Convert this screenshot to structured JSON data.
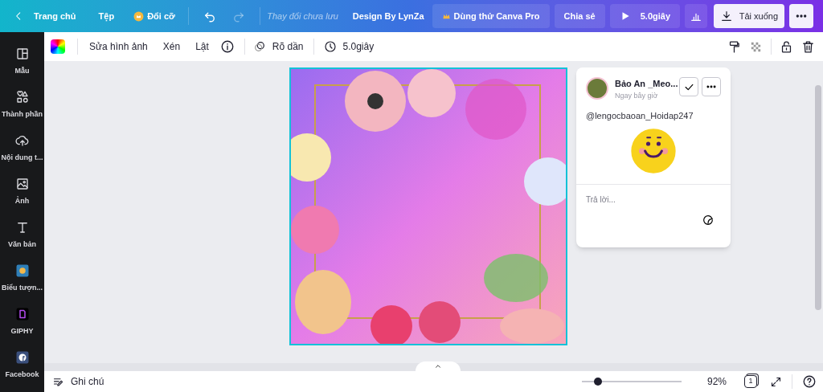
{
  "topbar": {
    "back": "Trang chủ",
    "file": "Tệp",
    "resize": "Đổi cỡ",
    "history": [
      {
        "kind": "undo",
        "disabled": false
      },
      {
        "kind": "redo",
        "disabled": true
      }
    ],
    "status": "Thay đổi chưa lưu",
    "title": "Design By LynZa",
    "pro": "Dùng thử Canva Pro",
    "share": "Chia sẻ",
    "play": "5.0giây",
    "download": "Tải xuống"
  },
  "sidebar": {
    "items": [
      {
        "label": "Mẫu",
        "kind": "templates"
      },
      {
        "label": "Thành phần",
        "kind": "elements"
      },
      {
        "label": "Nội dung t...",
        "kind": "uploads"
      },
      {
        "label": "Ảnh",
        "kind": "photos"
      },
      {
        "label": "Văn bản",
        "kind": "text"
      },
      {
        "label": "Biểu tượn...",
        "kind": "emoji"
      },
      {
        "label": "GIPHY",
        "kind": "giphy"
      },
      {
        "label": "Facebook",
        "kind": "facebook"
      }
    ]
  },
  "toolbar": {
    "items": [
      "Sửa hình ảnh",
      "Xén",
      "Lật"
    ],
    "transition": "Rõ dần",
    "duration": "5.0giây"
  },
  "comment": {
    "author": "Bảo An _Meo...",
    "time": "Ngay bây giờ",
    "text": "@lengocbaoan_Hoidap247",
    "reply_placeholder": "Trả lời..."
  },
  "footer": {
    "notes": "Ghi chú",
    "zoom": {
      "level": 0.16,
      "reading": "92%"
    },
    "page": "1"
  }
}
